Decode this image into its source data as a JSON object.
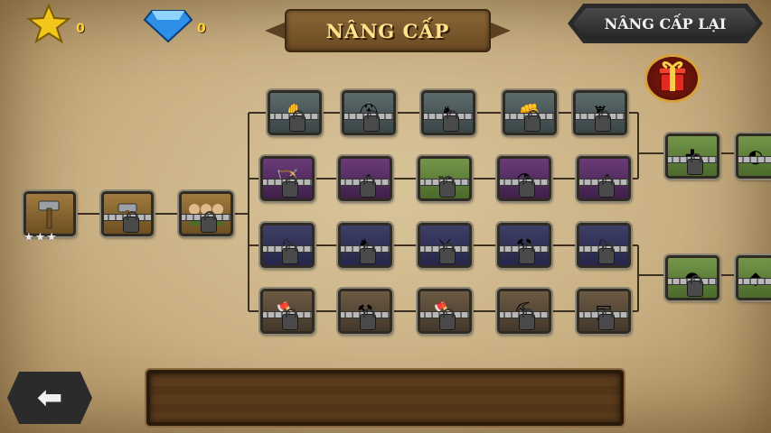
{
  "header": {
    "stars_count": "0",
    "gems_count": "0",
    "title": "NÂNG CẤP",
    "reset_label": "NÂNG CẤP LẠI"
  },
  "icons": {
    "star": "star-icon",
    "gem": "gem-icon",
    "gift": "gift-icon",
    "back": "back-arrow-icon",
    "lock": "lock-icon"
  },
  "colors": {
    "counter_text": "#ffd23a",
    "title_text": "#ffe28a",
    "gift_ring": "#d7a23a"
  },
  "tree": {
    "root": {
      "stars": "★★★",
      "status": "unlocked"
    },
    "tier1": {
      "status": "locked"
    },
    "tier2": {
      "status": "locked"
    },
    "rows": [
      {
        "branch": "soldiers",
        "nodes": [
          "locked",
          "locked",
          "locked",
          "locked",
          "locked"
        ]
      },
      {
        "branch": "archers",
        "nodes": [
          "locked",
          "locked",
          "locked",
          "locked",
          "locked"
        ]
      },
      {
        "branch": "cavalry",
        "nodes": [
          "locked",
          "locked",
          "locked",
          "locked",
          "locked"
        ]
      },
      {
        "branch": "engineers",
        "nodes": [
          "locked",
          "locked",
          "locked",
          "locked",
          "locked"
        ]
      }
    ],
    "extra": [
      "locked",
      "locked",
      "locked",
      "locked"
    ]
  }
}
